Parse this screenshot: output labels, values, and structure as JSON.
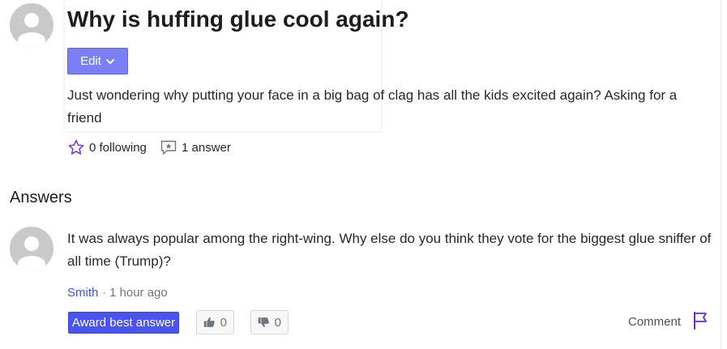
{
  "question": {
    "title": "Why is huffing glue cool again?",
    "edit_label": "Edit",
    "body": "Just wondering why putting your face in a big bag of clag has all the kids excited again? Asking for a friend",
    "following": "0 following",
    "answers_count": "1 answer"
  },
  "answers_section": {
    "heading": "Answers",
    "items": [
      {
        "body": "It was always popular among the right-wing. Why else do you think they vote for the biggest glue sniffer of all time (Trump)?",
        "author": "Smith",
        "separator": "·",
        "time": "1 hour ago",
        "award_label": "Award best answer",
        "thumbs_up": "0",
        "thumbs_down": "0",
        "comment_label": "Comment"
      }
    ]
  },
  "colors": {
    "edit_button": "#7b7ff7",
    "award_button": "#4b53f1",
    "author_link": "#3a5bd6",
    "star_icon": "#7c3aed",
    "flag_icon": "#6a2bd9"
  },
  "icons": [
    "avatar-placeholder-icon",
    "chevron-down-icon",
    "star-icon",
    "answer-bubble-icon",
    "thumbs-up-icon",
    "thumbs-down-icon",
    "flag-icon"
  ]
}
